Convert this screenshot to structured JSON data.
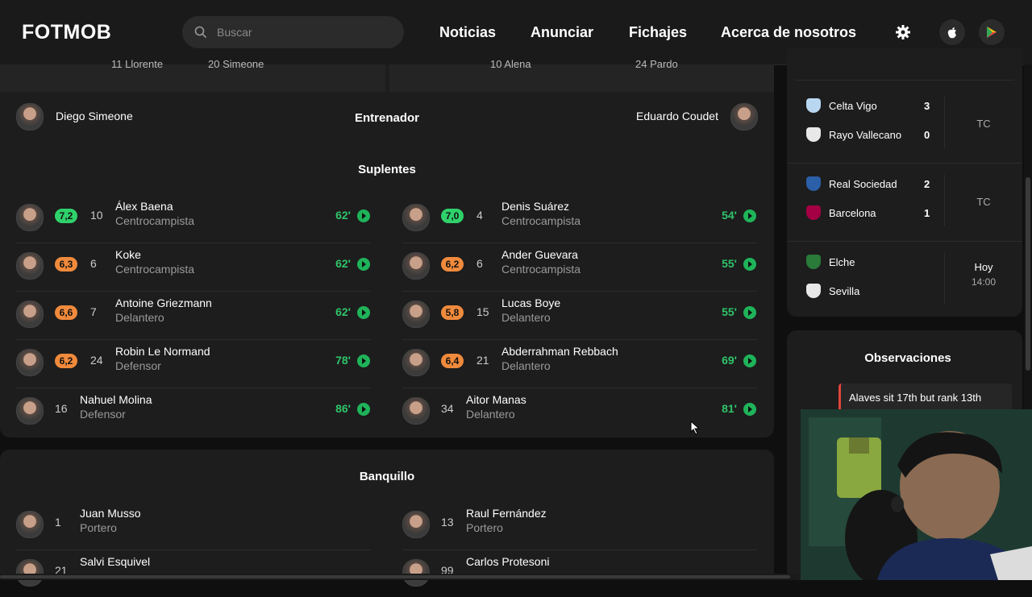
{
  "header": {
    "logo": "FOTMOB",
    "search_placeholder": "Buscar",
    "nav": [
      "Noticias",
      "Anunciar",
      "Fichajes",
      "Acerca de nosotros"
    ]
  },
  "lineup_strip": {
    "left": [
      "11 Llorente",
      "20 Simeone"
    ],
    "right": [
      "10 Alena",
      "24 Pardo"
    ]
  },
  "coach": {
    "home": "Diego Simeone",
    "label": "Entrenador",
    "away": "Eduardo Coudet"
  },
  "subs_title": "Suplentes",
  "subs_home": [
    {
      "rating": "7,2",
      "rating_color": "#2fd16b",
      "number": "10",
      "name": "Álex Baena",
      "position": "Centrocampista",
      "minute": "62'"
    },
    {
      "rating": "6,3",
      "rating_color": "#f08a3c",
      "number": "6",
      "name": "Koke",
      "position": "Centrocampista",
      "minute": "62'"
    },
    {
      "rating": "6,6",
      "rating_color": "#f08a3c",
      "number": "7",
      "name": "Antoine Griezmann",
      "position": "Delantero",
      "minute": "62'"
    },
    {
      "rating": "6,2",
      "rating_color": "#f08a3c",
      "number": "24",
      "name": "Robin Le Normand",
      "position": "Defensor",
      "minute": "78'"
    },
    {
      "rating": "",
      "rating_color": "",
      "number": "16",
      "name": "Nahuel Molina",
      "position": "Defensor",
      "minute": "86'"
    }
  ],
  "subs_away": [
    {
      "rating": "7,0",
      "rating_color": "#2fd16b",
      "number": "4",
      "name": "Denis Suárez",
      "position": "Centrocampista",
      "minute": "54'"
    },
    {
      "rating": "6,2",
      "rating_color": "#f08a3c",
      "number": "6",
      "name": "Ander Guevara",
      "position": "Centrocampista",
      "minute": "55'"
    },
    {
      "rating": "5,8",
      "rating_color": "#f08a3c",
      "number": "15",
      "name": "Lucas Boye",
      "position": "Delantero",
      "minute": "55'"
    },
    {
      "rating": "6,4",
      "rating_color": "#f08a3c",
      "number": "21",
      "name": "Abderrahman Rebbach",
      "position": "Delantero",
      "minute": "69'"
    },
    {
      "rating": "",
      "rating_color": "",
      "number": "34",
      "name": "Aitor Manas",
      "position": "Delantero",
      "minute": "81'"
    }
  ],
  "bench_title": "Banquillo",
  "bench_home": [
    {
      "number": "1",
      "name": "Juan Musso",
      "position": "Portero"
    },
    {
      "number": "21",
      "name": "Salvi Esquivel",
      "position": ""
    }
  ],
  "bench_away": [
    {
      "number": "13",
      "name": "Raul Fernández",
      "position": "Portero"
    },
    {
      "number": "99",
      "name": "Carlos Protesoni",
      "position": ""
    }
  ],
  "matches": [
    {
      "home": "Celta Vigo",
      "home_score": "3",
      "away": "Rayo Vallecano",
      "away_score": "0",
      "status": "TC",
      "time": ""
    },
    {
      "home": "Real Sociedad",
      "home_score": "2",
      "away": "Barcelona",
      "away_score": "1",
      "status": "TC",
      "time": ""
    },
    {
      "home": "Elche",
      "home_score": "",
      "away": "Sevilla",
      "away_score": "",
      "status": "Hoy",
      "time": "14:00"
    }
  ],
  "observations": {
    "title": "Observaciones",
    "text": "Alaves sit 17th but rank 13th"
  },
  "colors": {
    "accent_green": "#2fc46a",
    "rating_orange": "#f08a3c",
    "rating_green": "#2fd16b"
  }
}
